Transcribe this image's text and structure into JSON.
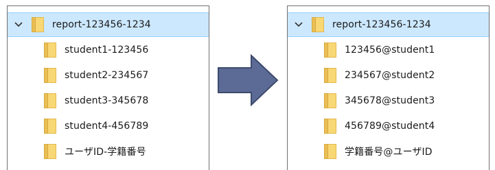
{
  "left_tree": {
    "root_label": "report-123456-1234",
    "children": [
      {
        "label": "student1-123456"
      },
      {
        "label": "student2-234567"
      },
      {
        "label": "student3-345678"
      },
      {
        "label": "student4-456789"
      },
      {
        "label": "ユーザID-学籍番号"
      }
    ]
  },
  "right_tree": {
    "root_label": "report-123456-1234",
    "children": [
      {
        "label": "123456@student1"
      },
      {
        "label": "234567@student2"
      },
      {
        "label": "345678@student3"
      },
      {
        "label": "456789@student4"
      },
      {
        "label": "学籍番号@ユーザID"
      }
    ]
  },
  "icons": {
    "expand": "chevron-down-icon",
    "folder": "folder-icon",
    "arrow": "right-arrow-icon"
  },
  "colors": {
    "selection_bg": "#cce8ff",
    "selection_border": "#99d1ff",
    "folder_fill": "#f8d775",
    "folder_dark": "#e3b94d",
    "arrow_fill": "#5b6b96",
    "arrow_stroke": "#3d4a6c"
  }
}
